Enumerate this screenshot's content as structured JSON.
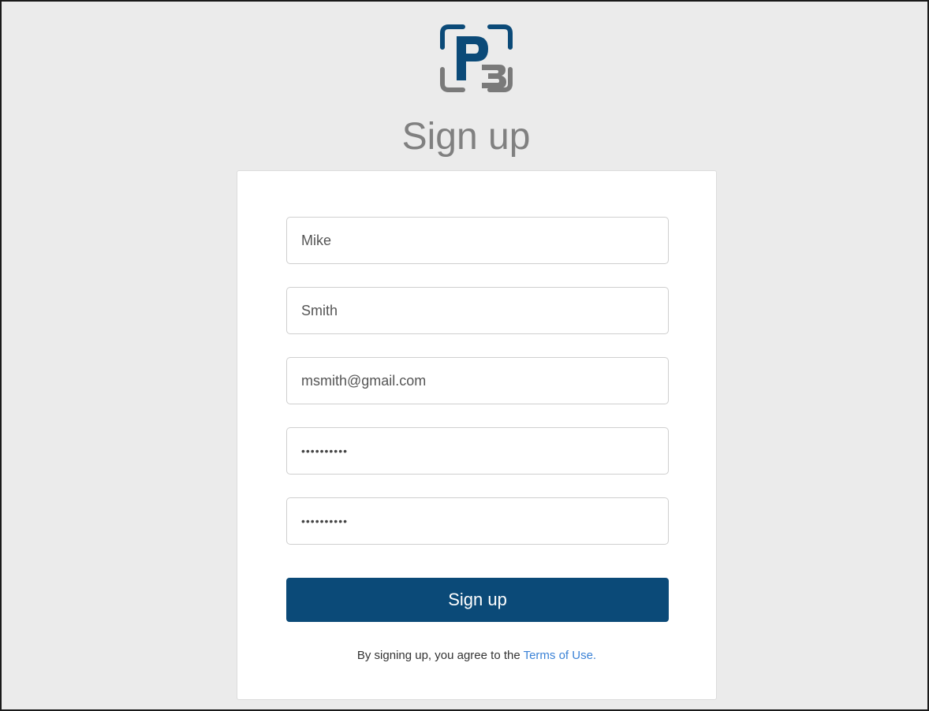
{
  "brand": {
    "logo_icon": "p3-logo-icon",
    "primary_color": "#0b4a78",
    "accent_color": "#808080"
  },
  "page": {
    "title": "Sign up"
  },
  "form": {
    "first_name_value": "Mike",
    "last_name_value": "Smith",
    "email_value": "msmith@gmail.com",
    "password_value": "••••••••••",
    "confirm_password_value": "••••••••••",
    "submit_label": "Sign up",
    "terms_prefix": "By signing up, you agree to the ",
    "terms_link_label": "Terms of Use."
  }
}
